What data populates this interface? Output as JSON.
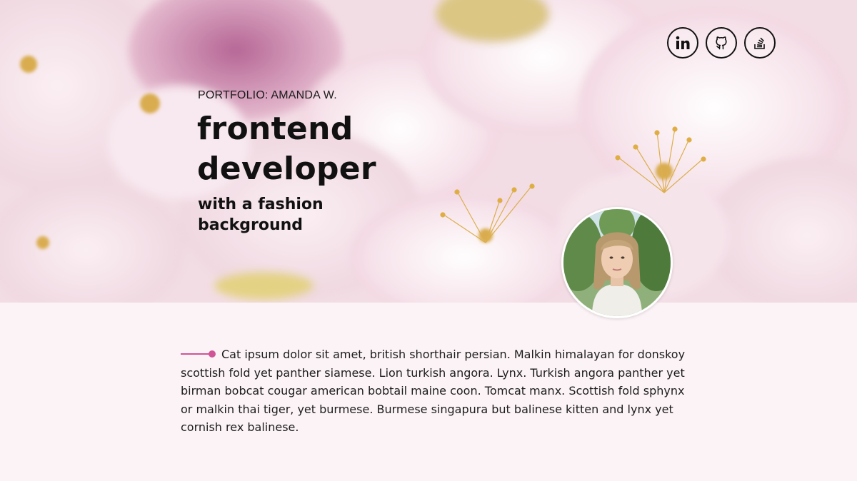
{
  "header": {
    "kicker": "PORTFOLIO: AMANDA W.",
    "title_line1": "frontend",
    "title_line2": "developer",
    "subtitle_line1": "with a fashion",
    "subtitle_line2": "background"
  },
  "social": [
    {
      "icon": "linkedin-icon"
    },
    {
      "icon": "github-icon"
    },
    {
      "icon": "stack-overflow-icon"
    }
  ],
  "intro": {
    "text": "Cat ipsum dolor sit amet, british shorthair persian. Malkin himalayan for donskoy scottish fold yet panther siamese. Lion turkish angora. Lynx. Turkish angora panther yet birman bobcat cougar american bobtail maine coon. Tomcat manx. Scottish fold sphynx or malkin thai tiger, yet burmese. Burmese singapura but balinese kitten and lynx yet cornish rex balinese."
  },
  "colors": {
    "accent": "#d05596",
    "page_background": "#fcf3f6",
    "text": "#111111"
  }
}
